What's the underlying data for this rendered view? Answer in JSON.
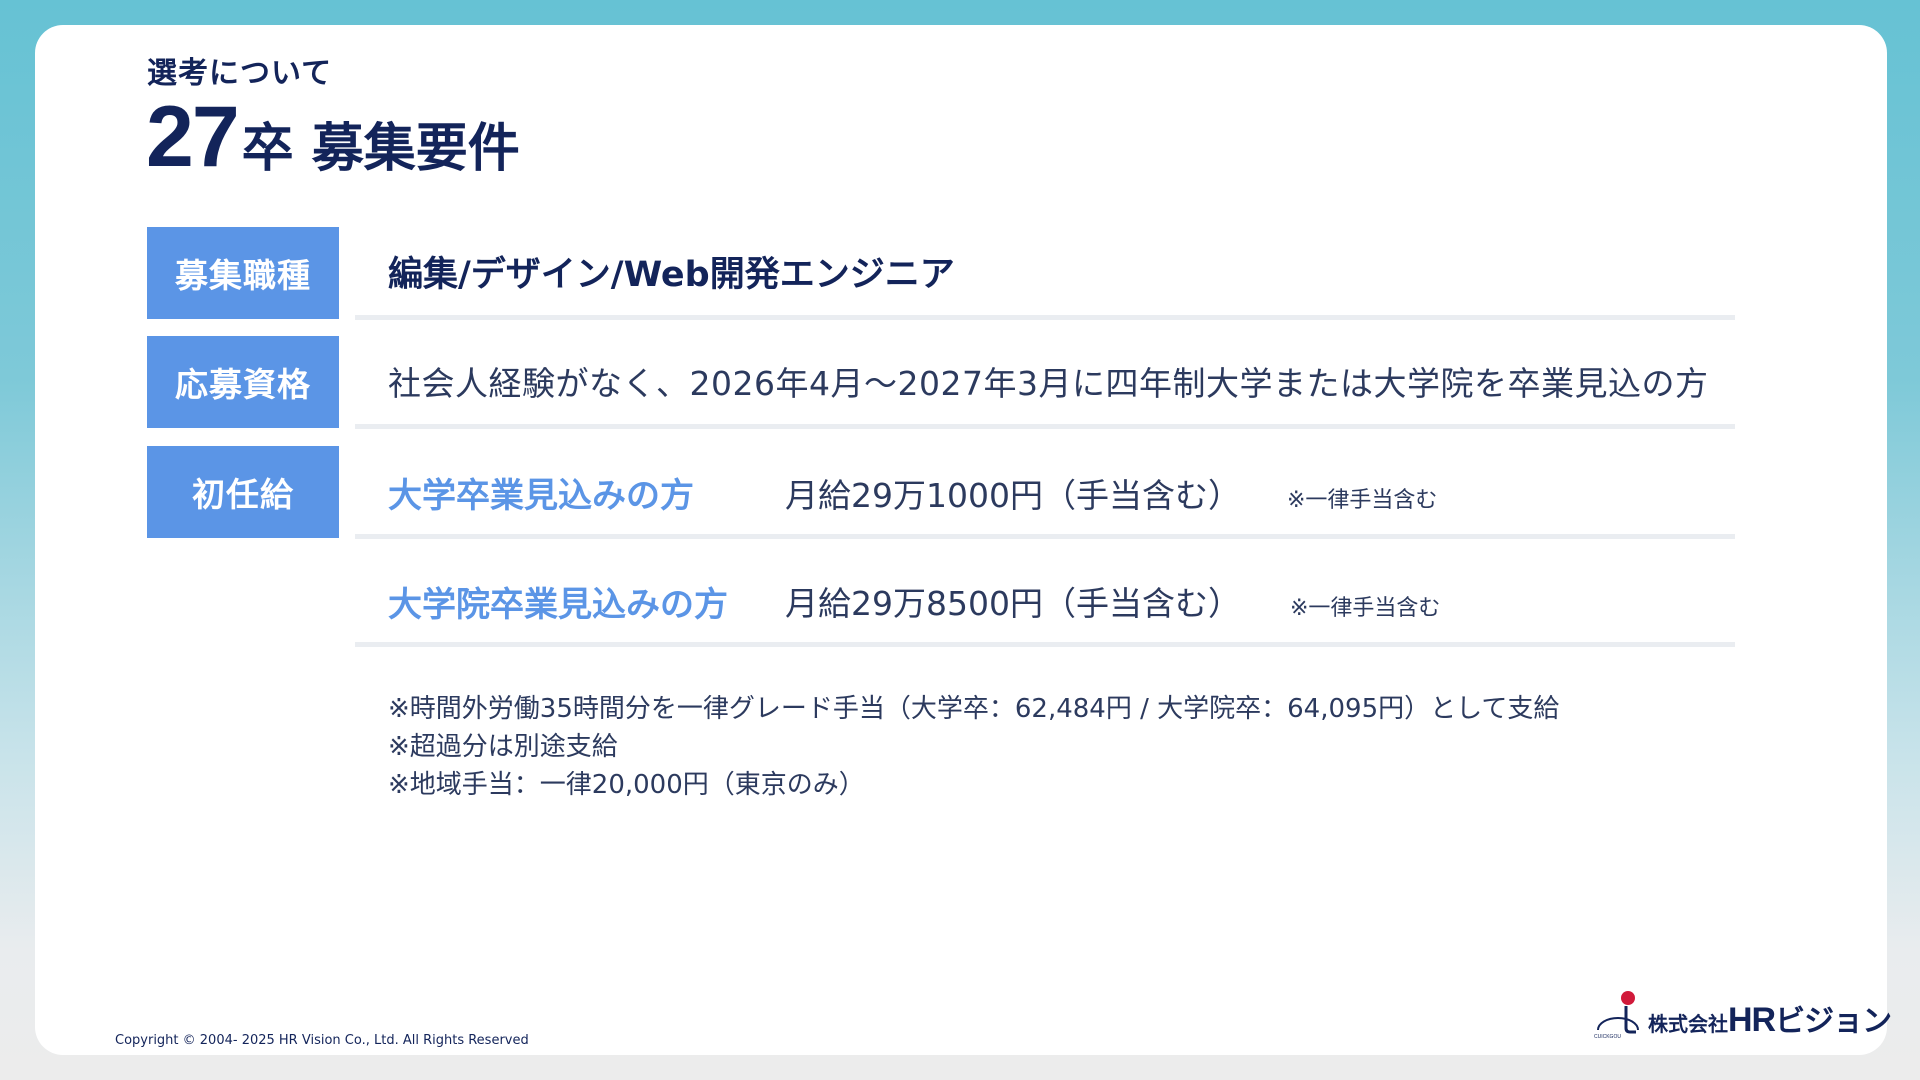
{
  "header": {
    "subtitle": "選考について",
    "title_number": "27",
    "title_rest": "卒 募集要件"
  },
  "rows": {
    "job": {
      "label": "募集職種",
      "value": "編集/デザイン/Web開発エンジニア"
    },
    "qualification": {
      "label": "応募資格",
      "value": "社会人経験がなく、2026年4月～2027年3月に四年制大学または大学院を卒業見込の方"
    },
    "salary": {
      "label": "初任給",
      "items": [
        {
          "category": "大学卒業見込みの方",
          "amount": "月給29万1000円（手当含む）",
          "note": "※一律手当含む"
        },
        {
          "category": "大学院卒業見込みの方",
          "amount": "月給29万8500円（手当含む）",
          "note": "※一律手当含む"
        }
      ]
    }
  },
  "notes": [
    "※時間外労働35時間分を一律グレード手当（大学卒：62,484円 / 大学院卒：64,095円）として支給",
    "※超過分は別途支給",
    "※地域手当：一律20,000円（東京のみ）"
  ],
  "footer": {
    "copyright": "Copyright © 2004- 2025 HR Vision Co., Ltd. All Rights Reserved",
    "logo_company_prefix": "株式会社",
    "logo_hr": "HR",
    "logo_kana": "ビジョン",
    "logo_small_text": "CUICKGOU"
  },
  "colors": {
    "navy": "#13245a",
    "accent_blue": "#5b95e6",
    "logo_red": "#d11a3a",
    "background_teal": "#66c2d4"
  }
}
